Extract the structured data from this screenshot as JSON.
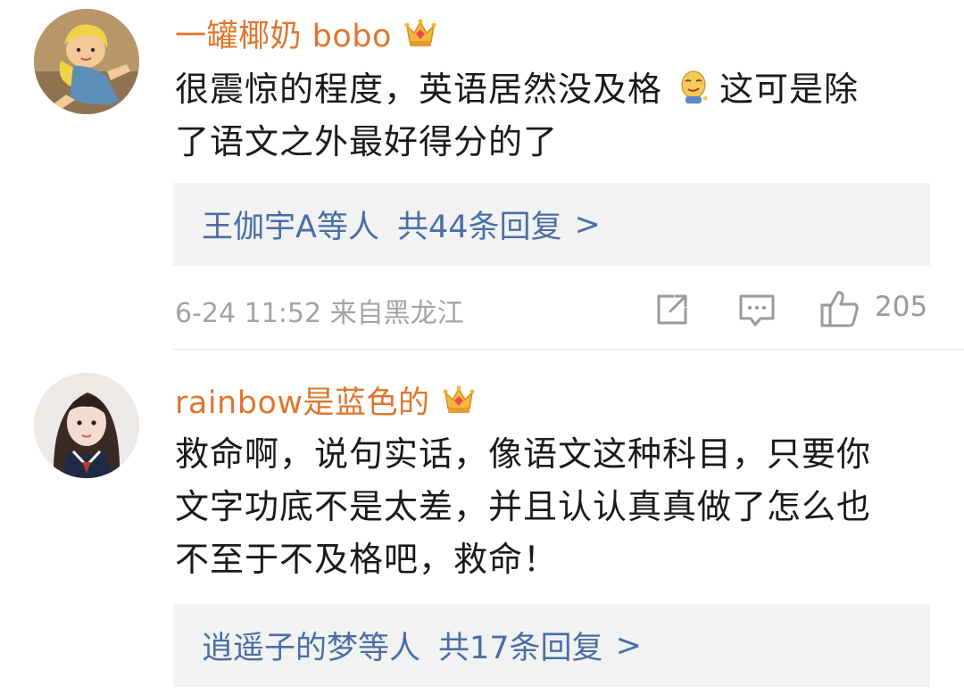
{
  "comments": [
    {
      "username": "一罐椰奶 bobo",
      "text_line1": "很震惊的程度，英语居然没及格",
      "text_line1_after_emoji": "这可是除",
      "text_line2": "了语文之外最好得分的了",
      "replies_names": "王伽宇A等人",
      "replies_count": "共44条回复",
      "reply_chevron": ">",
      "timestamp_location": "6-24 11:52  来自黑龙江",
      "likes": "205",
      "icons": [
        "avatar-cartoon",
        "crown-badge-icon",
        "smirk-emoji-icon",
        "share-icon",
        "comment-icon",
        "thumbs-up-icon"
      ]
    },
    {
      "username": "rainbow是蓝色的",
      "text_line1": "救命啊，说句实话，像语文这种科目，只要你",
      "text_line2": "文字功底不是太差，并且认认真真做了怎么也",
      "text_line3": "不至于不及格吧，救命！",
      "replies_names": "逍遥子的梦等人",
      "replies_count": "共17条回复",
      "reply_chevron": ">",
      "icons": [
        "avatar-photo",
        "crown-badge-icon"
      ]
    }
  ],
  "colors": {
    "username": "#e0762d",
    "reply_link": "#4a6ea5",
    "reply_bg": "#f2f2f2",
    "meta": "#a3a3a3"
  }
}
